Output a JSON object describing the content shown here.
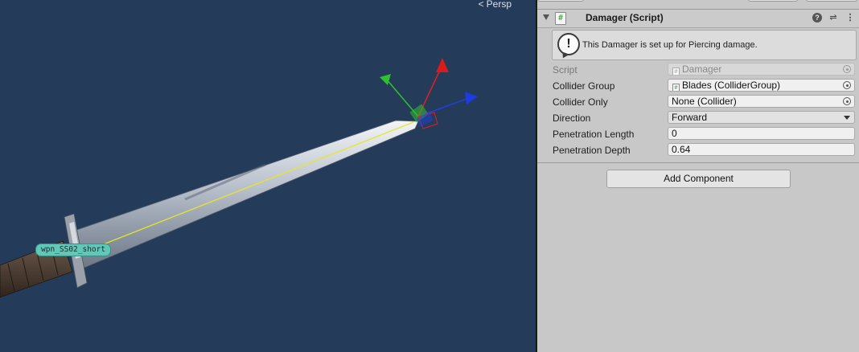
{
  "scene": {
    "projection_label": "Persp",
    "object_label": "wpn_SS02_short"
  },
  "component": {
    "title": "Damager (Script)",
    "icons": {
      "script": "script-hash-icon",
      "help": "help-icon",
      "preset": "preset-sliders-icon",
      "more": "kebab-menu-icon"
    }
  },
  "helpbox": {
    "icon": "info-exclamation-icon",
    "text": "This Damager is set up for Piercing damage."
  },
  "fields": {
    "script": {
      "label": "Script",
      "value": "Damager"
    },
    "collider_group": {
      "label": "Collider Group",
      "value": "Blades (ColliderGroup)"
    },
    "collider_only": {
      "label": "Collider Only",
      "value": "None (Collider)"
    },
    "direction": {
      "label": "Direction",
      "value": "Forward"
    },
    "penetration_length": {
      "label": "Penetration Length",
      "value": "0"
    },
    "penetration_depth": {
      "label": "Penetration Depth",
      "value": "0.64"
    }
  },
  "add_component_label": "Add Component",
  "colors": {
    "scene_bg": "#243b59",
    "inspector_bg": "#c8c8c8",
    "label_tag": "#5fc8b8",
    "gizmo_x": "#e02020",
    "gizmo_y": "#30c030",
    "gizmo_z": "#2040e0"
  }
}
